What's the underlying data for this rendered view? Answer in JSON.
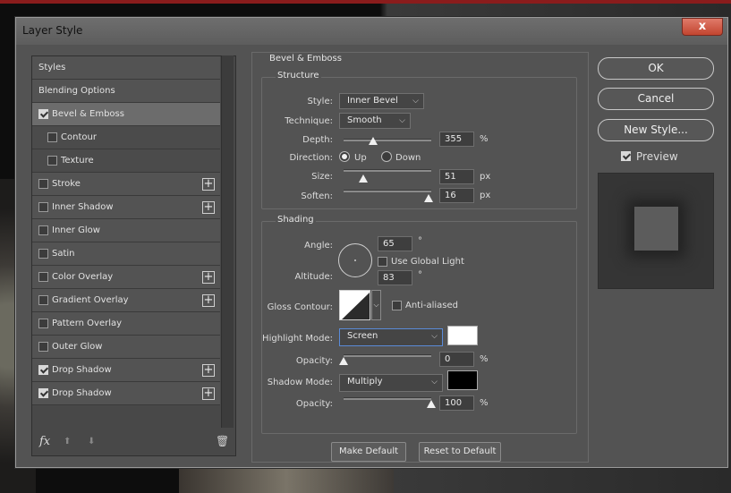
{
  "window": {
    "title": "Layer Style",
    "close_label": "x"
  },
  "styles_list": [
    {
      "label": "Styles",
      "kind": "header"
    },
    {
      "label": "Blending Options",
      "kind": "header"
    },
    {
      "label": "Bevel & Emboss",
      "kind": "effect",
      "checked": true,
      "selected": true
    },
    {
      "label": "Contour",
      "kind": "sub",
      "checked": false
    },
    {
      "label": "Texture",
      "kind": "sub",
      "checked": false
    },
    {
      "label": "Stroke",
      "kind": "effect",
      "checked": false,
      "plus": true
    },
    {
      "label": "Inner Shadow",
      "kind": "effect",
      "checked": false,
      "plus": true
    },
    {
      "label": "Inner Glow",
      "kind": "effect",
      "checked": false
    },
    {
      "label": "Satin",
      "kind": "effect",
      "checked": false
    },
    {
      "label": "Color Overlay",
      "kind": "effect",
      "checked": false,
      "plus": true
    },
    {
      "label": "Gradient Overlay",
      "kind": "effect",
      "checked": false,
      "plus": true
    },
    {
      "label": "Pattern Overlay",
      "kind": "effect",
      "checked": false
    },
    {
      "label": "Outer Glow",
      "kind": "effect",
      "checked": false
    },
    {
      "label": "Drop Shadow",
      "kind": "effect",
      "checked": true,
      "plus": true
    },
    {
      "label": "Drop Shadow",
      "kind": "effect",
      "checked": true,
      "plus": true
    }
  ],
  "footer_icons": {
    "fx_label": "fx"
  },
  "bevel": {
    "section_title": "Bevel & Emboss",
    "structure_title": "Structure",
    "style_label": "Style:",
    "style_value": "Inner Bevel",
    "technique_label": "Technique:",
    "technique_value": "Smooth",
    "depth_label": "Depth:",
    "depth_value": "355",
    "depth_unit": "%",
    "depth_slider": 0.34,
    "direction_label": "Direction:",
    "direction_up": "Up",
    "direction_down": "Down",
    "size_label": "Size:",
    "size_value": "51",
    "size_unit": "px",
    "size_slider": 0.22,
    "soften_label": "Soften:",
    "soften_value": "16",
    "soften_unit": "px",
    "soften_slider": 0.97
  },
  "shading": {
    "title": "Shading",
    "angle_label": "Angle:",
    "angle_value": "65",
    "angle_unit": "°",
    "global_light_label": "Use Global Light",
    "altitude_label": "Altitude:",
    "altitude_value": "83",
    "altitude_unit": "°",
    "gloss_label": "Gloss Contour:",
    "antialiased_label": "Anti-aliased",
    "highlight_label": "Highlight Mode:",
    "highlight_value": "Screen",
    "highlight_color": "#ffffff",
    "highlight_opacity_label": "Opacity:",
    "highlight_opacity_value": "0",
    "highlight_opacity_unit": "%",
    "highlight_opacity_slider": 0.0,
    "shadow_label": "Shadow Mode:",
    "shadow_value": "Multiply",
    "shadow_color": "#000000",
    "shadow_opacity_label": "Opacity:",
    "shadow_opacity_value": "100",
    "shadow_opacity_unit": "%",
    "shadow_opacity_slider": 1.0
  },
  "bottom_buttons": {
    "make_default": "Make Default",
    "reset_default": "Reset to Default"
  },
  "right": {
    "ok": "OK",
    "cancel": "Cancel",
    "new_style": "New Style...",
    "preview_label": "Preview",
    "preview_checked": true
  }
}
